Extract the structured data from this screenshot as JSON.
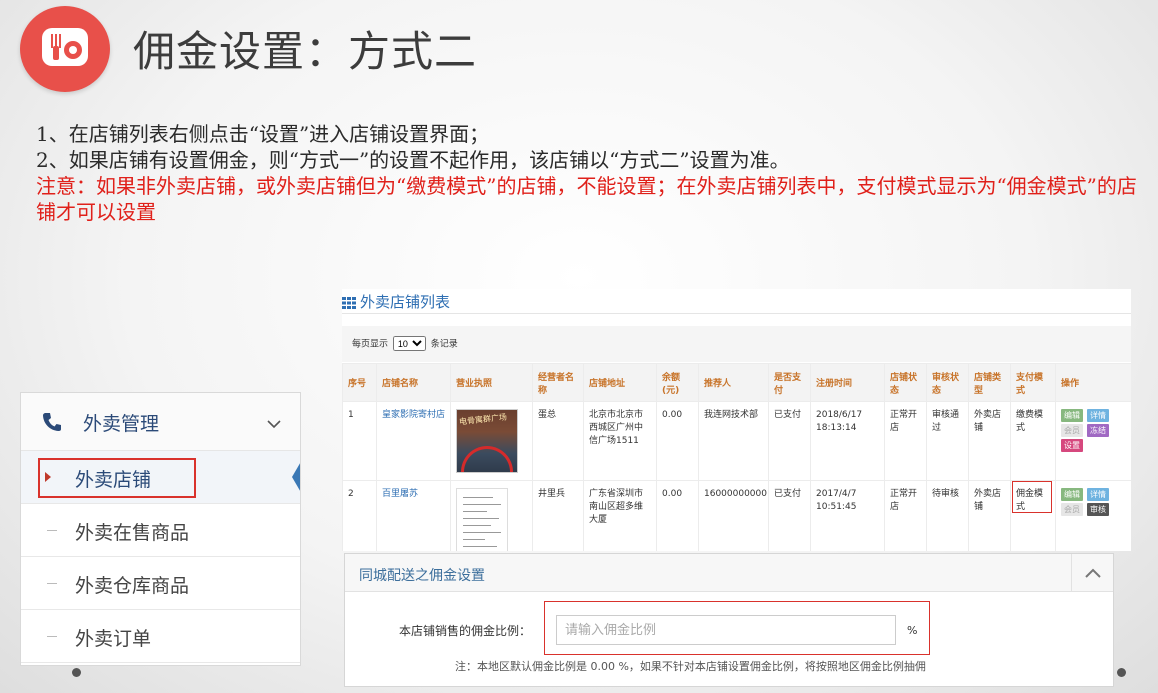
{
  "slide": {
    "title": "佣金设置：方式二",
    "lines": [
      "1、在店铺列表右侧点击“设置”进入店铺设置界面；",
      "2、如果店铺有设置佣金，则“方式一”的设置不起作用，该店铺以“方式二”设置为准。"
    ],
    "note": "注意：如果非外卖店铺，或外卖店铺但为“缴费模式”的店铺，不能设置；在外卖店铺列表中，支付模式显示为“佣金模式”的店铺才可以设置"
  },
  "sidebar": {
    "section": "外卖管理",
    "items": [
      {
        "label": "外卖店铺"
      },
      {
        "label": "外卖在售商品"
      },
      {
        "label": "外卖仓库商品"
      },
      {
        "label": "外卖订单"
      }
    ]
  },
  "store_list": {
    "title": "外卖店铺列表",
    "page_size_prefix": "每页显示",
    "page_size": "10",
    "page_size_suffix": "条记录",
    "columns": [
      "序号",
      "店铺名称",
      "营业执照",
      "经营者名称",
      "店铺地址",
      "余额(元)",
      "推荐人",
      "是否支付",
      "注册时间",
      "店铺状态",
      "审核状态",
      "店铺类型",
      "支付模式",
      "操作"
    ],
    "rows": [
      {
        "no": "1",
        "name": "皇家影院寄村店",
        "license_text": "电骨寓群广场",
        "owner": "蛋总",
        "address": "北京市北京市西城区广州中信广场1511",
        "balance": "0.00",
        "referrer": "我连网技术部",
        "paid": "已支付",
        "reg_time": "2018/6/17 18:13:14",
        "status": "正常开店",
        "review": "审核通过",
        "type": "外卖店铺",
        "pay_mode": "缴费模式",
        "actions": [
          "编辑",
          "详情",
          "会员",
          "冻结",
          "设置"
        ]
      },
      {
        "no": "2",
        "name": "百里屠苏",
        "owner": "井里兵",
        "address": "广东省深圳市南山区超多维大厦",
        "balance": "0.00",
        "referrer": "16000000000",
        "paid": "已支付",
        "reg_time": "2017/4/7 10:51:45",
        "status": "正常开店",
        "review": "待审核",
        "type": "外卖店铺",
        "pay_mode": "佣金模式",
        "actions": [
          "编辑",
          "详情",
          "会员",
          "审核"
        ]
      }
    ]
  },
  "commission": {
    "title": "同城配送之佣金设置",
    "field_label": "本店铺销售的佣金比例：",
    "placeholder": "请输入佣金比例",
    "unit": "%",
    "hint": "注：本地区默认佣金比例是 0.00 %，如果不针对本店铺设置佣金比例，将按照地区佣金比例抽佣"
  },
  "colors": {
    "accent_red": "#d9322c",
    "logo": "#e8504a",
    "link_blue": "#2f6fb3"
  },
  "icons": [
    "logo-icon",
    "phone-icon",
    "chevron-down-icon",
    "grid-icon",
    "chevron-up-icon"
  ]
}
